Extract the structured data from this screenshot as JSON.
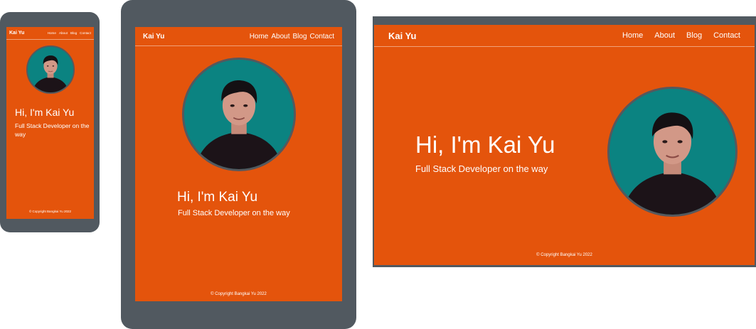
{
  "site": {
    "brand": "Kai Yu",
    "nav": [
      "Home",
      "About",
      "Blog",
      "Contact"
    ],
    "hero_title": "Hi, I'm Kai Yu",
    "hero_subtitle": "Full Stack Developer on the way",
    "footer": "© Copyright Bangkai Yu 2022"
  },
  "colors": {
    "accent": "#e4540c",
    "device_frame": "#515960",
    "avatar_background": "#0b8381",
    "text": "#ffffff"
  }
}
